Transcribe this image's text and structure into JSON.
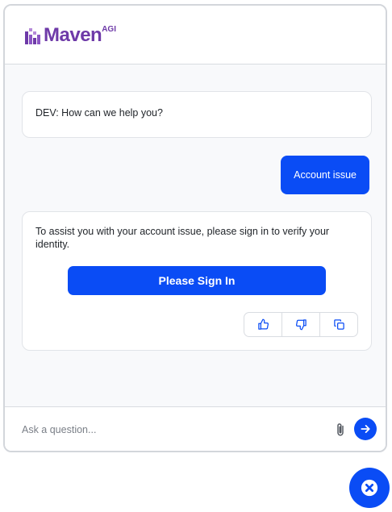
{
  "header": {
    "logo_text": "Maven",
    "logo_sup": "AGI"
  },
  "messages": {
    "greeting": "DEV: How can we help you?",
    "user_message": "Account issue",
    "reply": "To assist you with your account issue, please sign in to verify your identity.",
    "signin_label": "Please Sign In"
  },
  "feedback": {
    "icons": [
      "thumbs-up-icon",
      "thumbs-down-icon",
      "copy-icon"
    ]
  },
  "composer": {
    "placeholder": "Ask a question...",
    "value": ""
  },
  "colors": {
    "accent": "#0a4cf5",
    "brand": "#6e3aa8",
    "panel_bg": "#f8f9fb",
    "border": "#d9dce1"
  }
}
